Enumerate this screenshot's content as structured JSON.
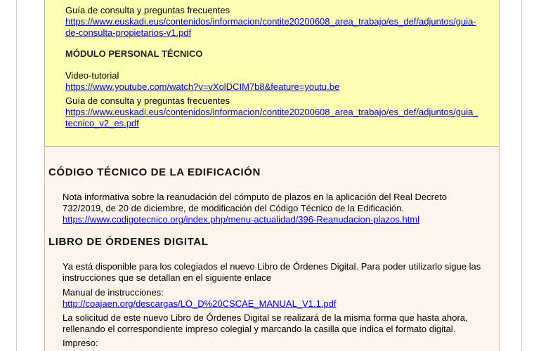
{
  "propietarios": {
    "guide_label": "Guía de consulta y preguntas frecuentes",
    "guide_url_line1": "https://www.euskadi.eus/contenidos/informacion/contite20200608_area_trabajo/es_def/adjuntos/guia-",
    "guide_url_line2": "de-consulta-propietarios-v1.pdf"
  },
  "modulo_tecnico": {
    "title": "MÓDULO PERSONAL TÉCNICO",
    "video_label": "Video-tutorial",
    "video_url": "https://www.youtube.com/watch?v=vXolDCIM7b8&feature=youtu.be",
    "guide_label": "Guía de consulta y preguntas frecuentes",
    "guide_url_line1": "https://www.euskadi.eus/contenidos/informacion/contite20200608_area_trabajo/es_def/adjuntos/guia_",
    "guide_url_line2": "tecnico_v2_es.pdf"
  },
  "cte": {
    "title": "CÓDIGO TÉCNICO DE LA EDIFICACIÓN",
    "note_line1": "Nota informativa sobre la reanudación del cómputo de plazos en la aplicación del Real Decreto",
    "note_line2": "732/2019, de 20 de diciembre, de modificación del Código Técnico de la Edificación.",
    "url": "https://www.codigotecnico.org/index.php/menu-actualidad/396-Reanudacion-plazos.html"
  },
  "libro": {
    "title": "LIBRO DE ÓRDENES DIGITAL",
    "intro_line1": "Ya está disponible para los colegiados el nuevo Libro de Órdenes Digital. Para poder utilizarlo sigue las",
    "intro_line2": "instrucciones que se detallan en el siguiente enlace",
    "manual_label": "Manual de instrucciones:",
    "manual_url": "http://coajaen.org/descargas/LO_D%20CSCAE_MANUAL_V1.1.pdf",
    "request_line1": "La solicitud de este nuevo Libro de Órdenes Digital se realizará de la misma forma que hasta ahora,",
    "request_line2": "rellenando el correspondiente impreso colegial y marcando la casilla que indica el formato digital.",
    "impreso_label": "Impreso:"
  }
}
